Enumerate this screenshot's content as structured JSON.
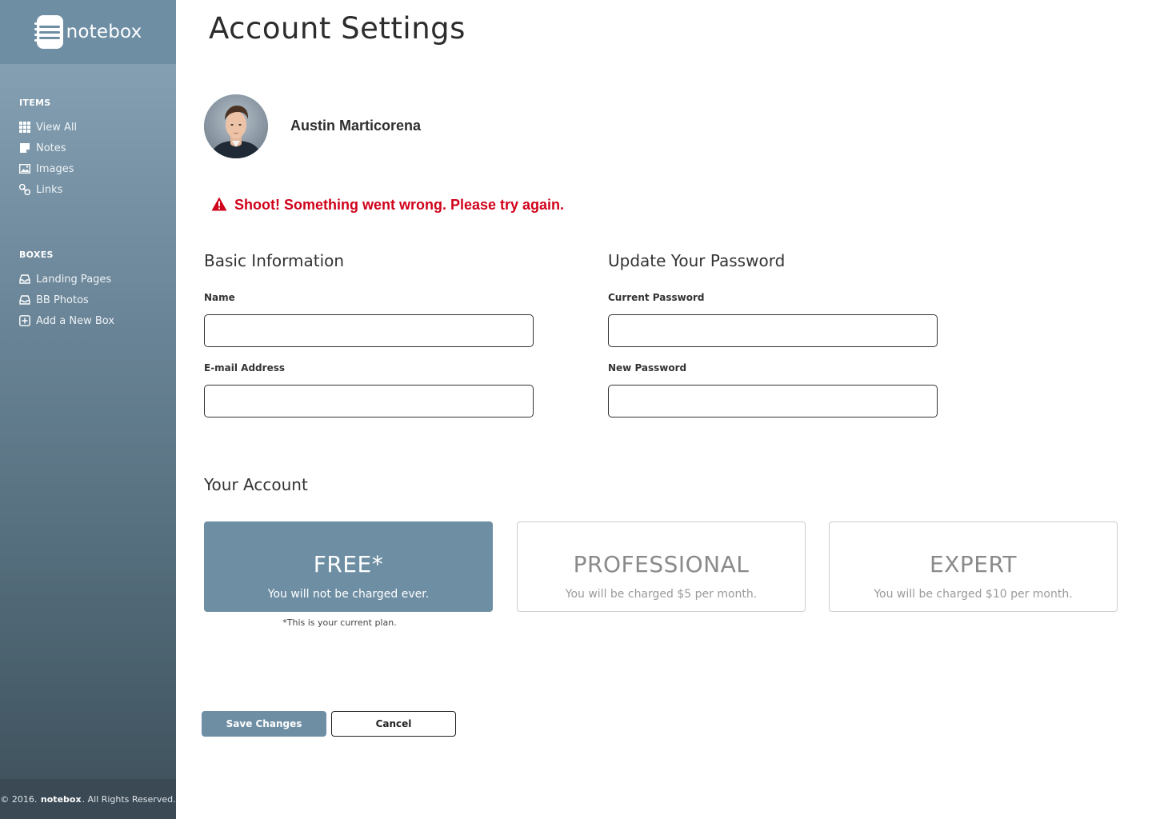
{
  "brand": {
    "name": "notebox",
    "accent": "#6e8ea4",
    "error_color": "#d0021b"
  },
  "sidebar": {
    "sections": [
      {
        "heading": "ITEMS",
        "items": [
          {
            "label": "View All",
            "icon": "grid-icon"
          },
          {
            "label": "Notes",
            "icon": "note-icon"
          },
          {
            "label": "Images",
            "icon": "image-icon"
          },
          {
            "label": "Links",
            "icon": "link-icon"
          }
        ]
      },
      {
        "heading": "BOXES",
        "items": [
          {
            "label": "Landing Pages",
            "icon": "inbox-icon"
          },
          {
            "label": "BB Photos",
            "icon": "inbox-icon"
          },
          {
            "label": "Add a New Box",
            "icon": "plus-square-icon"
          }
        ]
      }
    ],
    "footer": {
      "prefix": "© 2016.",
      "brand": "notebox",
      "suffix": ". All Rights Reserved."
    }
  },
  "page": {
    "title": "Account Settings"
  },
  "profile": {
    "name": "Austin Marticorena"
  },
  "alert": {
    "message": "Shoot! Something went wrong. Please try again."
  },
  "basic_info": {
    "title": "Basic Information",
    "name_label": "Name",
    "name_value": "",
    "email_label": "E-mail Address",
    "email_value": ""
  },
  "password": {
    "title": "Update Your Password",
    "current_label": "Current Password",
    "current_value": "",
    "new_label": "New Password",
    "new_value": ""
  },
  "account": {
    "title": "Your Account",
    "plans": [
      {
        "name": "FREE*",
        "desc": "You will not be charged ever.",
        "selected": true
      },
      {
        "name": "PROFESSIONAL",
        "desc": "You will be charged $5 per month.",
        "selected": false
      },
      {
        "name": "EXPERT",
        "desc": "You will be charged $10 per month.",
        "selected": false
      }
    ],
    "note": "*This is your current plan."
  },
  "actions": {
    "save_label": "Save Changes",
    "cancel_label": "Cancel"
  }
}
